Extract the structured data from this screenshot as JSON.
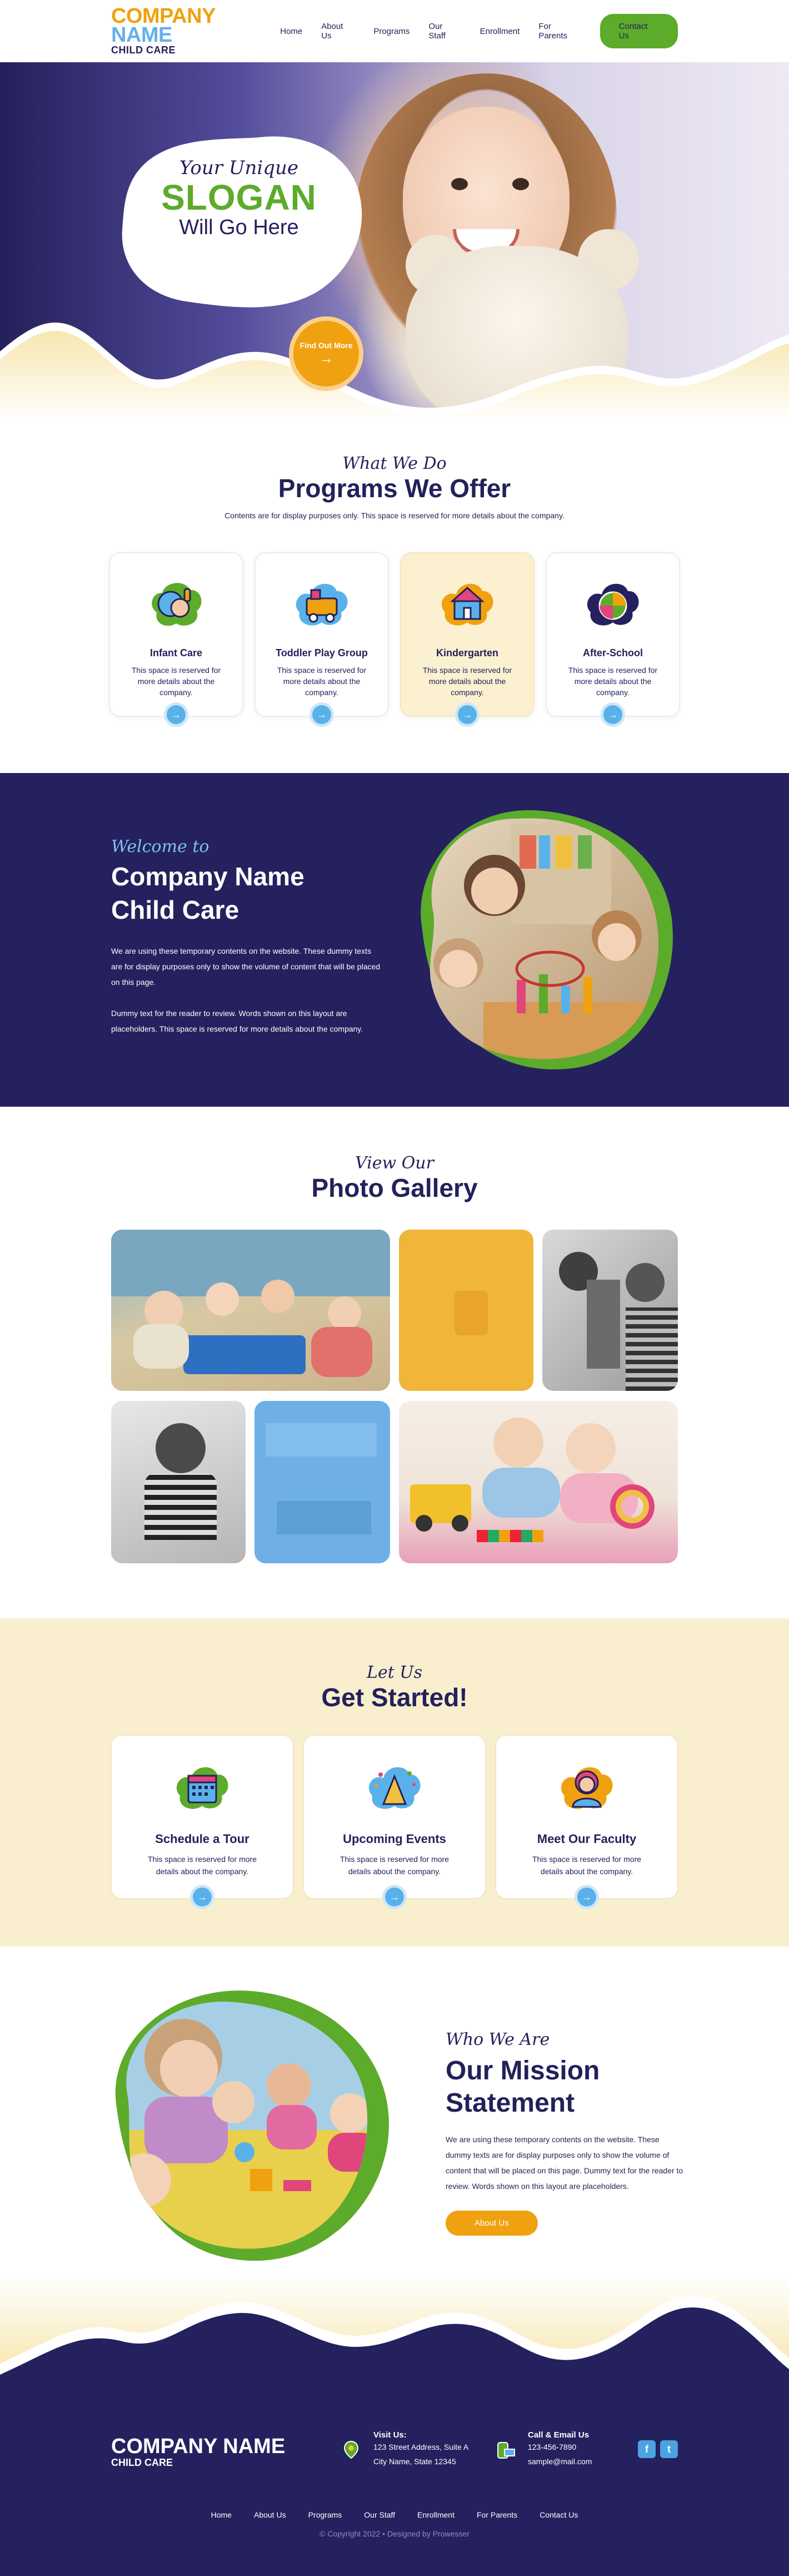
{
  "brand": {
    "name_part1": "COMPANY",
    "name_part2": "NAME",
    "tagline": "CHILD CARE"
  },
  "nav": {
    "items": [
      "Home",
      "About Us",
      "Programs",
      "Our Staff",
      "Enrollment",
      "For Parents"
    ],
    "cta": "Contact Us"
  },
  "hero": {
    "line1": "Your Unique",
    "line2": "SLOGAN",
    "line3": "Will Go Here",
    "cta": "Find Out More",
    "cta_arrow": "→"
  },
  "programs": {
    "script": "What We Do",
    "title": "Programs We Offer",
    "subtitle": "Contents are for display purposes only. This space is reserved for more details about the company.",
    "cards": [
      {
        "title": "Infant Care",
        "text": "This space is reserved for more details about the company.",
        "icon": "baby-icon"
      },
      {
        "title": "Toddler Play Group",
        "text": "This space is reserved for more details about the company.",
        "icon": "toy-train-icon"
      },
      {
        "title": "Kindergarten",
        "text": "This space is reserved for more details about the company.",
        "icon": "school-house-icon"
      },
      {
        "title": "After-School",
        "text": "This space is reserved for more details about the company.",
        "icon": "ball-icon"
      }
    ]
  },
  "welcome": {
    "script": "Welcome to",
    "title_line1": "Company Name",
    "title_line2": "Child Care",
    "para1": "We are using these temporary contents on the website. These dummy texts are for display purposes only to show the volume of content that will be placed on this page.",
    "para2": "Dummy text for the reader to review. Words shown on this layout are placeholders. This space is reserved for more details about the company."
  },
  "gallery": {
    "script": "View Our",
    "title": "Photo Gallery"
  },
  "started": {
    "script": "Let Us",
    "title": "Get Started!",
    "cards": [
      {
        "title": "Schedule a Tour",
        "text": "This space is reserved for more details about the company.",
        "icon": "calendar-icon"
      },
      {
        "title": "Upcoming Events",
        "text": "This space is reserved for more details about the company.",
        "icon": "party-popper-icon"
      },
      {
        "title": "Meet Our Faculty",
        "text": "This space is reserved for more details about the company.",
        "icon": "teacher-icon"
      }
    ]
  },
  "mission": {
    "script": "Who We Are",
    "title_line1": "Our Mission",
    "title_line2": "Statement",
    "text": "We are using these temporary contents on the website. These dummy texts are for display purposes only to show the volume of content that will be placed on this page. Dummy text for the reader to review. Words shown on this layout are placeholders.",
    "cta": "About Us"
  },
  "footer": {
    "logo_line1": "COMPANY NAME",
    "logo_line2": "CHILD CARE",
    "visit_title": "Visit Us:",
    "visit_line1": "123 Street Address, Suite A",
    "visit_line2": "City Name, State 12345",
    "call_title": "Call & Email Us",
    "phone": "123-456-7890",
    "email": "sample@mail.com",
    "social": [
      "f",
      "t"
    ],
    "nav": [
      "Home",
      "About Us",
      "Programs",
      "Our Staff",
      "Enrollment",
      "For Parents",
      "Contact Us"
    ],
    "copyright": "© Copyright 2022  •  Designed by Prowesser"
  },
  "colors": {
    "navy": "#24215e",
    "green": "#5cab2b",
    "orange": "#f0a10f",
    "sky": "#5ab1ea",
    "cream": "#f9efcf"
  }
}
